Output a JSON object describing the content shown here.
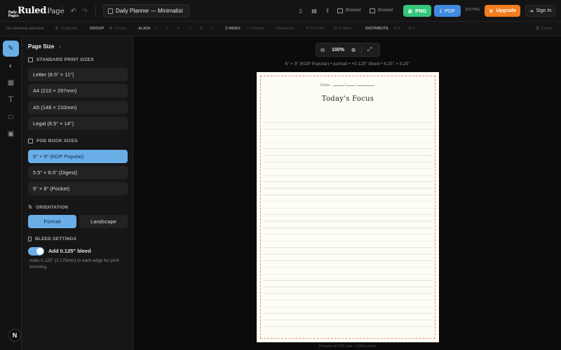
{
  "app": {
    "logo_small": "Daily Pages",
    "logo_main": "Ruled",
    "logo_sub": "Page",
    "document_title": "Daily Planner — Minimalist"
  },
  "topbar": {
    "browser1_label": "Browser",
    "browser2_label": "Browser",
    "png_label": "PNG",
    "pdf_label": "PDF",
    "png_count": "3/3 PNG",
    "upgrade_label": "Upgrade",
    "signin_label": "Sign In"
  },
  "toolbar": {
    "selection_status": "No elements selected",
    "duplicate": "Duplicate",
    "group_label": "GROUP",
    "group_btn": "Group",
    "align_label": "ALIGN",
    "zindex_label": "Z-INDEX",
    "forward": "Forward",
    "backward": "Backward",
    "to_front": "To Front",
    "to_back": "To Back",
    "distribute_label": "DISTRIBUTE",
    "dist_h": "H",
    "dist_v": "V",
    "delete": "Delete"
  },
  "panel": {
    "title": "Page Size",
    "standard_heading": "STANDARD PRINT SIZES",
    "standard_sizes": [
      "Letter (8.5\" × 11\")",
      "A4 (210 × 297mm)",
      "A5 (148 × 210mm)",
      "Legal (8.5\" × 14\")"
    ],
    "pod_heading": "POD BOOK SIZES",
    "pod_sizes": [
      "6\" × 9\" (KDP Popular)",
      "5.5\" × 8.5\" (Digest)",
      "5\" × 8\" (Pocket)"
    ],
    "orientation_heading": "ORIENTATION",
    "portrait": "Portrait",
    "landscape": "Landscape",
    "bleed_heading": "BLEED SETTINGS",
    "bleed_toggle_label": "Add 0.125\" bleed",
    "bleed_toggle_on": true,
    "bleed_note": "Adds 0.125\" (3.175mm) to each edge for print trimming."
  },
  "canvas": {
    "zoom": "100%",
    "size_info": "6\" × 9\" (KDP Popular) • portrait • +0.125\" bleed • 6.25\" × 9.25\"",
    "preview_note": "Preview at 78% fpw • 100% zoom"
  },
  "page": {
    "date_label": "Date:",
    "date_sep": "/",
    "title": "Today's Focus"
  },
  "colors": {
    "accent": "#6aaee8",
    "png_button": "#35c57b",
    "pdf_button": "#3f8ae0",
    "upgrade_button": "#f57c1f",
    "bleed_line": "#e58a8a",
    "paper": "#fdfdf3"
  }
}
